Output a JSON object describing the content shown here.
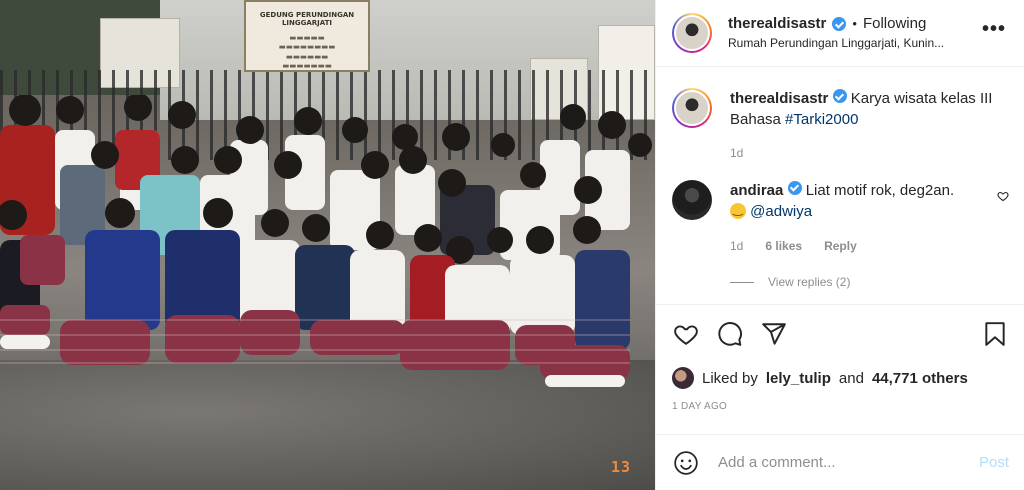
{
  "post": {
    "photo": {
      "sign_title": "GEDUNG PERUNDINGAN LINGGARJATI",
      "date_stamp": "13"
    }
  },
  "header": {
    "username": "therealdisastr",
    "separator": "•",
    "follow_label": "Following",
    "location": "Rumah Perundingan Linggarjati, Kunin...",
    "more_icon": "more-horizontal-icon"
  },
  "caption": {
    "username": "therealdisastr",
    "text": "Karya wisata kelas III Bahasa",
    "hashtag": "#Tarki2000",
    "time": "1d"
  },
  "comment": {
    "username": "andiraa",
    "text": "Liat motif rok, deg2an.",
    "mention": "@adwiya",
    "time": "1d",
    "likes": "6 likes",
    "reply_label": "Reply",
    "view_replies": "View replies (2)"
  },
  "actions": {
    "liked_prefix": "Liked by",
    "liked_user": "lely_tulip",
    "liked_and": "and",
    "liked_others": "44,771 others",
    "time_ago": "1 DAY AGO"
  },
  "add_comment": {
    "placeholder": "Add a comment...",
    "post_label": "Post"
  },
  "colors": {
    "verified": "#3897f0",
    "link": "#00376b",
    "post_disabled": "#b2dffc",
    "muted": "#8e8e8e"
  }
}
